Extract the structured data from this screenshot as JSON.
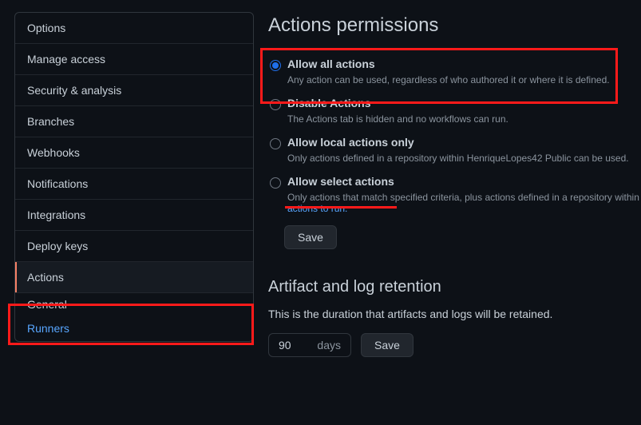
{
  "sidebar": {
    "items": [
      {
        "label": "Options"
      },
      {
        "label": "Manage access"
      },
      {
        "label": "Security & analysis"
      },
      {
        "label": "Branches"
      },
      {
        "label": "Webhooks"
      },
      {
        "label": "Notifications"
      },
      {
        "label": "Integrations"
      },
      {
        "label": "Deploy keys"
      },
      {
        "label": "Actions"
      }
    ],
    "sub": [
      {
        "label": "General"
      },
      {
        "label": "Runners"
      }
    ]
  },
  "main": {
    "title": "Actions permissions",
    "options": [
      {
        "label": "Allow all actions",
        "desc": "Any action can be used, regardless of who authored it or where it is defined.",
        "checked": true
      },
      {
        "label": "Disable Actions",
        "desc": "The Actions tab is hidden and no workflows can run.",
        "checked": false
      },
      {
        "label": "Allow local actions only",
        "desc": "Only actions defined in a repository within HenriqueLopes42 Public can be used.",
        "checked": false
      },
      {
        "label": "Allow select actions",
        "desc": "Only actions that match specified criteria, plus actions defined in a repository within ",
        "desc_tail": "actions to run.",
        "checked": false
      }
    ],
    "save": "Save",
    "retention": {
      "title": "Artifact and log retention",
      "desc": "This is the duration that artifacts and logs will be retained.",
      "value": "90",
      "unit": "days",
      "save": "Save"
    }
  }
}
